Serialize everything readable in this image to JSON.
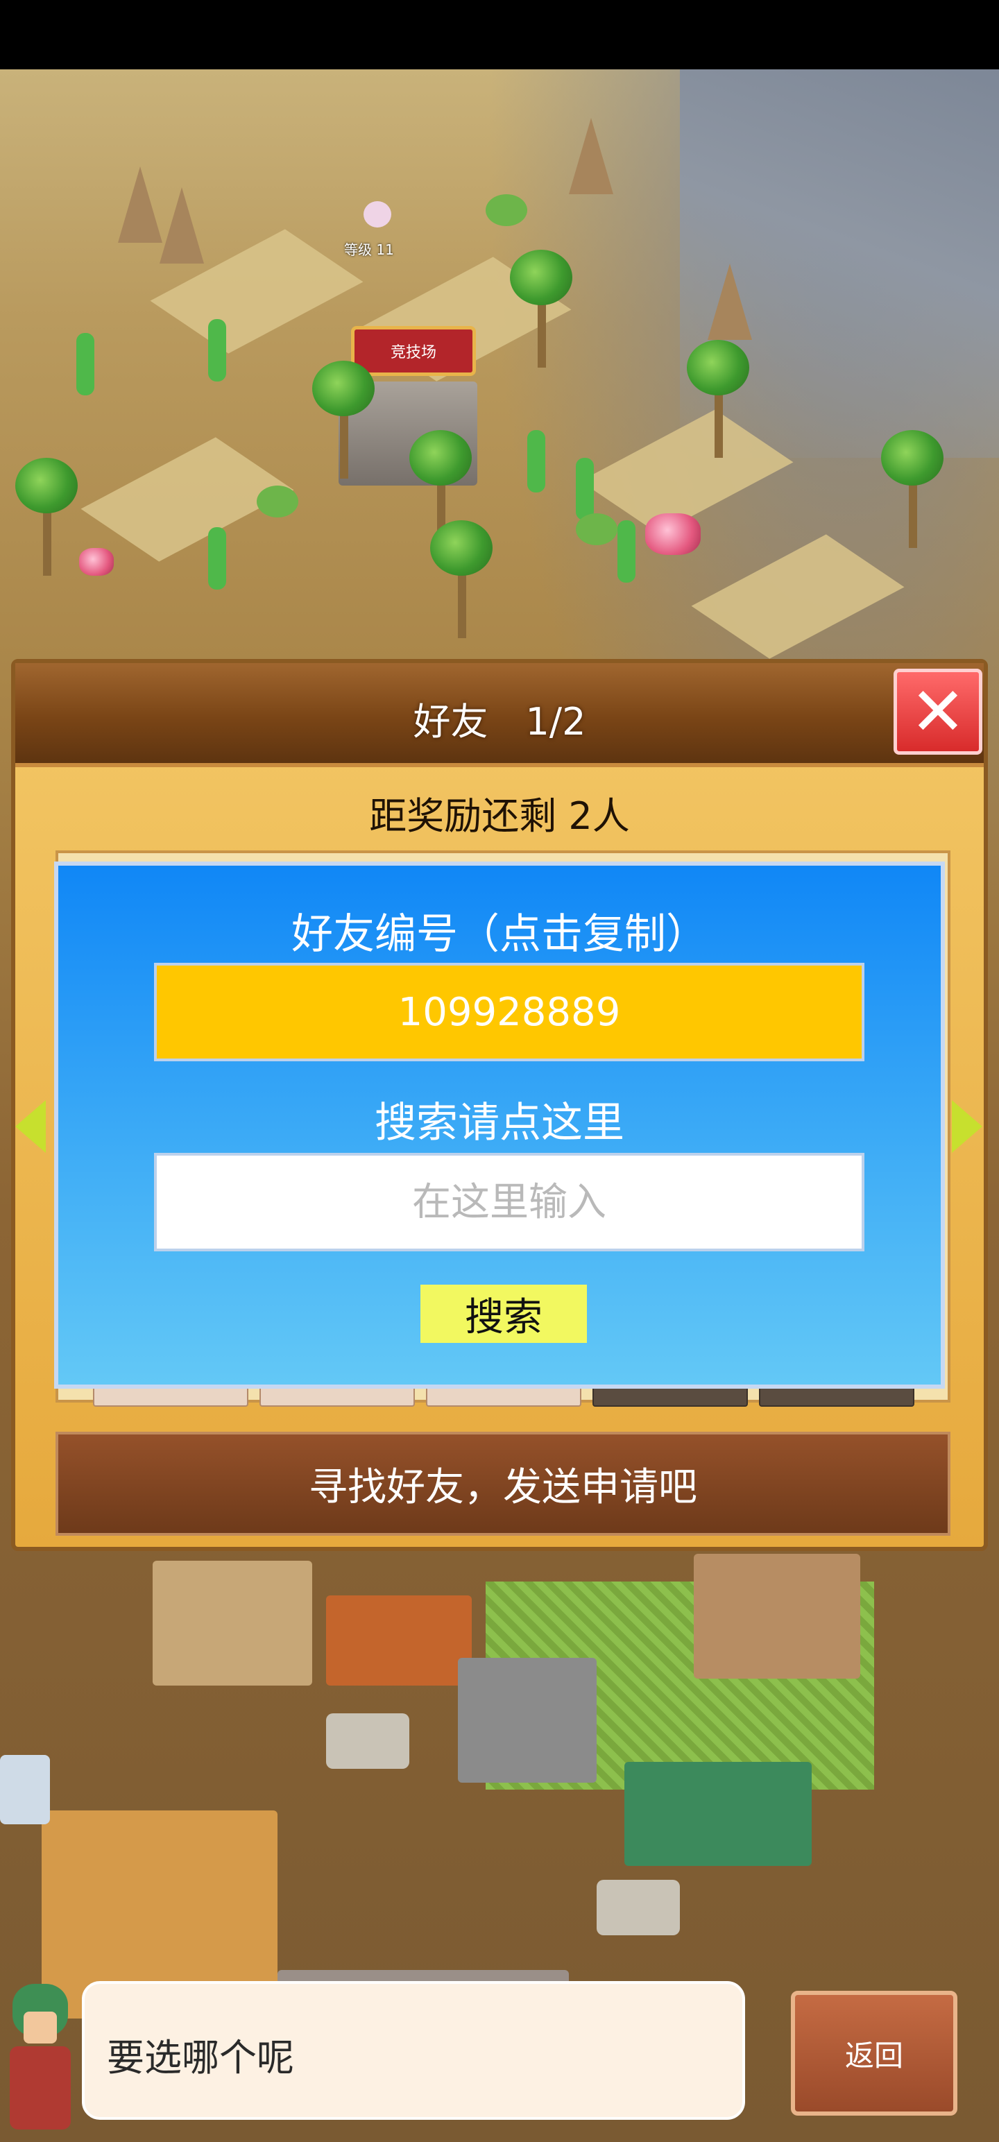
{
  "world": {
    "level_label": "等级 11",
    "arena_label": "竞技场"
  },
  "panel": {
    "title": "好友　1/2",
    "reward_text": "距奖励还剩 2人",
    "friend_id_dialog": {
      "title": "好友编号（点击复制）",
      "friend_id": "109928889",
      "search_title": "搜索请点这里",
      "search_placeholder": "在这里输入",
      "search_button_label": "搜索"
    },
    "find_friends_label": "寻找好友，发送申请吧"
  },
  "footer": {
    "speech_text": "要选哪个呢",
    "back_label": "返回"
  },
  "colors": {
    "panel_bg": "#e6a93d",
    "header_bg": "#7a4516",
    "dialog_blue": "#1087f6",
    "id_box": "#ffc700",
    "search_button": "#f2f860",
    "close_button": "#d82b2b"
  }
}
